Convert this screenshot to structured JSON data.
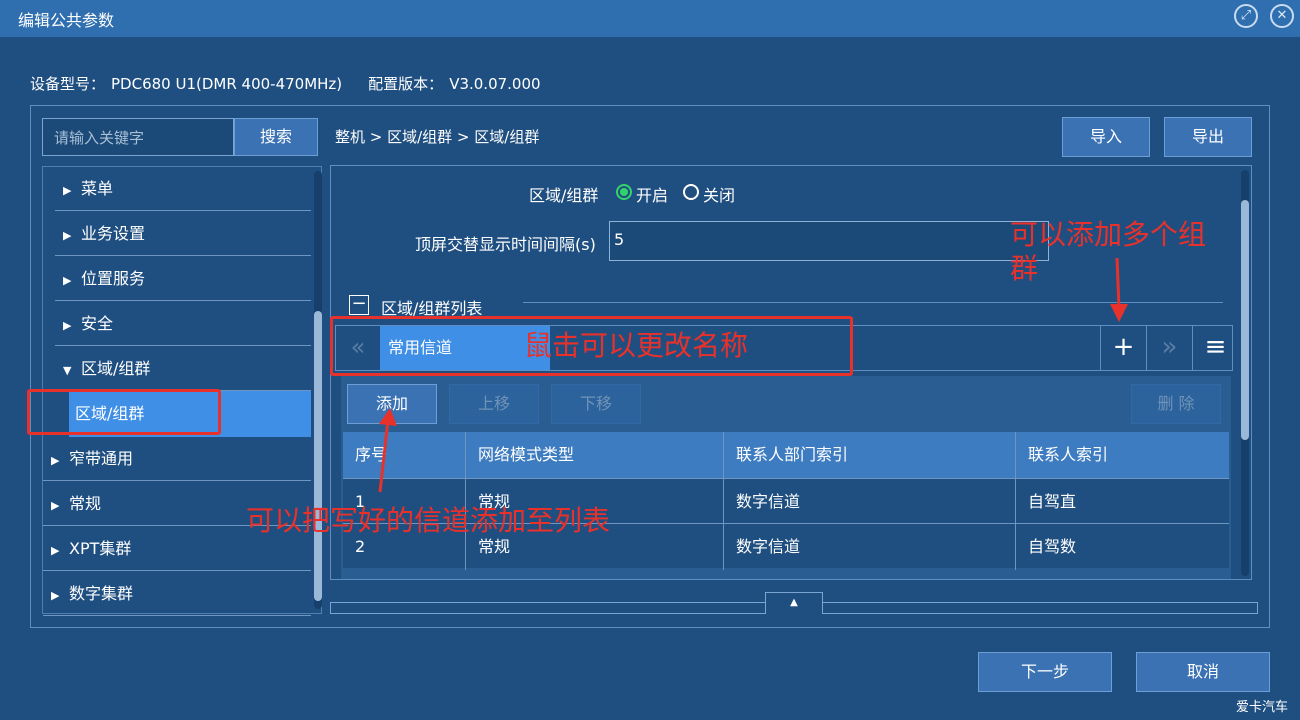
{
  "window": {
    "title": "编辑公共参数"
  },
  "device": {
    "model_label": "设备型号：",
    "model_value": "PDC680 U1(DMR 400-470MHz)",
    "config_label": "配置版本：",
    "config_value": "V3.0.07.000"
  },
  "search": {
    "placeholder": "请输入关键字",
    "button": "搜索"
  },
  "sidebar": {
    "items": [
      {
        "label": "菜单",
        "arrow": "▶"
      },
      {
        "label": "业务设置",
        "arrow": "▶"
      },
      {
        "label": "位置服务",
        "arrow": "▶"
      },
      {
        "label": "安全",
        "arrow": "▶"
      },
      {
        "label": "区域/组群",
        "arrow": "▼"
      },
      {
        "label": "窄带通用",
        "arrow": "▶"
      },
      {
        "label": "常规",
        "arrow": "▶"
      },
      {
        "label": "XPT集群",
        "arrow": "▶"
      },
      {
        "label": "数字集群",
        "arrow": "▶"
      }
    ],
    "sub_item": "区域/组群"
  },
  "breadcrumb": "整机 > 区域/组群 > 区域/组群",
  "toolbar": {
    "import": "导入",
    "export": "导出"
  },
  "form": {
    "zone_label": "区域/组群",
    "on_label": "开启",
    "off_label": "关闭",
    "interval_label": "顶屏交替显示时间间隔(s)",
    "interval_value": "5",
    "list_section": "区域/组群列表"
  },
  "tabs": {
    "active_tab": "常用信道",
    "prev_icon": "«",
    "next_icon": "»",
    "add_icon": "+",
    "menu_icon": "≡"
  },
  "list_toolbar": {
    "add": "添加",
    "up": "上移",
    "down": "下移",
    "delete": "删 除"
  },
  "table": {
    "headers": [
      "序号",
      "网络模式类型",
      "联系人部门索引",
      "联系人索引"
    ],
    "rows": [
      [
        "1",
        "常规",
        "数字信道",
        "自驾直"
      ],
      [
        "2",
        "常规",
        "数字信道",
        "自驾数"
      ]
    ]
  },
  "footer": {
    "next": "下一步",
    "cancel": "取消"
  },
  "annotations": {
    "rename": "鼠击可以更改名称",
    "add_groups": "可以添加多个组\n群",
    "add_to_list": "可以把写好的信道添加至列表"
  },
  "watermark": "爱卡汽车",
  "colors": {
    "background": "#1f4f80",
    "titlebar": "#2f6fb0",
    "accent": "#3f8fe6",
    "annotation": "#e8312b",
    "radio_on": "#33d36b"
  }
}
